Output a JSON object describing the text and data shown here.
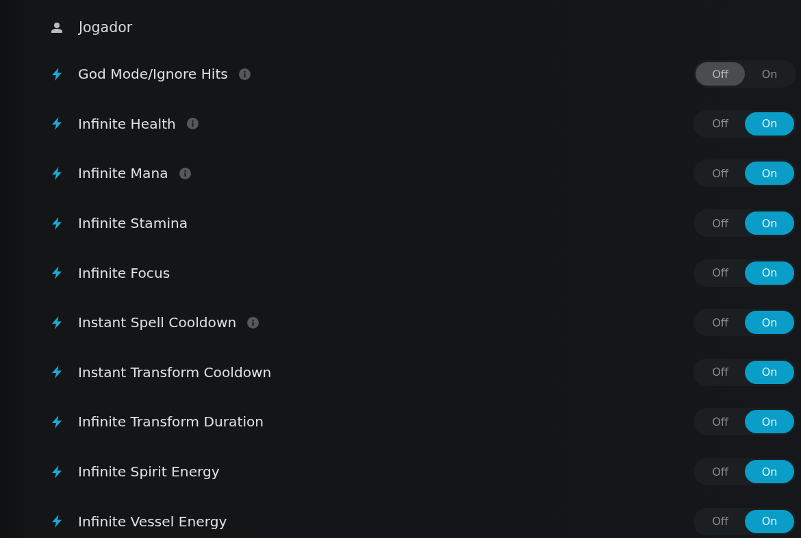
{
  "section": {
    "title": "Jogador"
  },
  "cheats": [
    {
      "label": "God Mode/Ignore Hits",
      "info": true,
      "options": [
        {
          "label": "Off",
          "selected": true
        },
        {
          "label": "On",
          "selected": false
        }
      ]
    },
    {
      "label": "Infinite Health",
      "info": true,
      "options": [
        {
          "label": "Off",
          "selected": false
        },
        {
          "label": "On",
          "selected": true
        }
      ]
    },
    {
      "label": "Infinite Mana",
      "info": true,
      "options": [
        {
          "label": "Off",
          "selected": false
        },
        {
          "label": "On",
          "selected": true
        }
      ]
    },
    {
      "label": "Infinite Stamina",
      "info": false,
      "options": [
        {
          "label": "Off",
          "selected": false
        },
        {
          "label": "On",
          "selected": true
        }
      ]
    },
    {
      "label": "Infinite Focus",
      "info": false,
      "options": [
        {
          "label": "Off",
          "selected": false
        },
        {
          "label": "On",
          "selected": true
        }
      ]
    },
    {
      "label": "Instant Spell Cooldown",
      "info": true,
      "options": [
        {
          "label": "Off",
          "selected": false
        },
        {
          "label": "On",
          "selected": true
        }
      ]
    },
    {
      "label": "Instant Transform Cooldown",
      "info": false,
      "options": [
        {
          "label": "Off",
          "selected": false
        },
        {
          "label": "On",
          "selected": true
        }
      ]
    },
    {
      "label": "Infinite Transform Duration",
      "info": false,
      "options": [
        {
          "label": "Off",
          "selected": false
        },
        {
          "label": "On",
          "selected": true
        }
      ]
    },
    {
      "label": "Infinite Spirit Energy",
      "info": false,
      "options": [
        {
          "label": "Off",
          "selected": false
        },
        {
          "label": "On",
          "selected": true
        }
      ]
    },
    {
      "label": "Infinite Vessel Energy",
      "info": false,
      "options": [
        {
          "label": "Off",
          "selected": false
        },
        {
          "label": "On",
          "selected": true
        }
      ]
    }
  ]
}
